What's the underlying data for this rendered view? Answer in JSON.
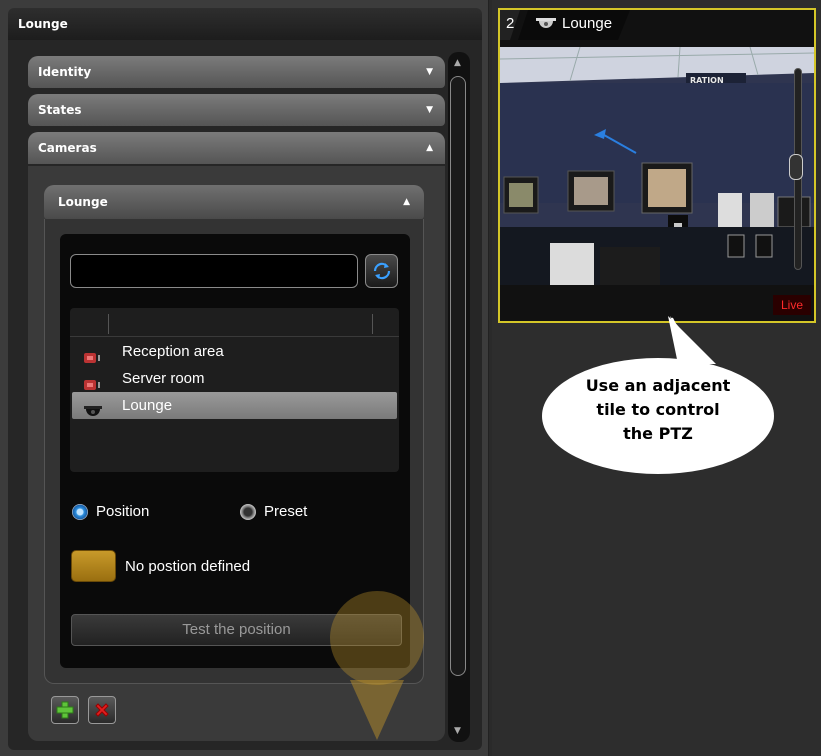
{
  "left_panel": {
    "title": "Lounge",
    "sections": [
      {
        "label": "Identity",
        "state": "collapsed"
      },
      {
        "label": "States",
        "state": "collapsed"
      },
      {
        "label": "Cameras",
        "state": "expanded"
      }
    ],
    "camera_card": {
      "title": "Lounge",
      "search": {
        "value": "",
        "placeholder": ""
      },
      "list_items": [
        {
          "label": "Reception area",
          "icon": "fixed-camera-icon",
          "selected": false
        },
        {
          "label": "Server room",
          "icon": "fixed-camera-icon",
          "selected": false
        },
        {
          "label": "Lounge",
          "icon": "ptz-dome-camera-icon",
          "selected": true
        }
      ],
      "radio_position": "Position",
      "radio_preset": "Preset",
      "selected_mode": "Position",
      "position_status": "No postion defined",
      "test_button": "Test the position"
    }
  },
  "right_panel": {
    "tile": {
      "number": "2",
      "name": "Lounge",
      "live_badge": "Live",
      "video_sign_text": "RATION"
    },
    "callout": {
      "lines": [
        "Use an adjacent",
        "tile to control",
        "the PTZ"
      ]
    }
  },
  "colors": {
    "tile_border": "#d4c628",
    "live_text": "#ff2a2a",
    "position_swatch": "#b8861c",
    "radio_selected": "#2a8fe0"
  }
}
